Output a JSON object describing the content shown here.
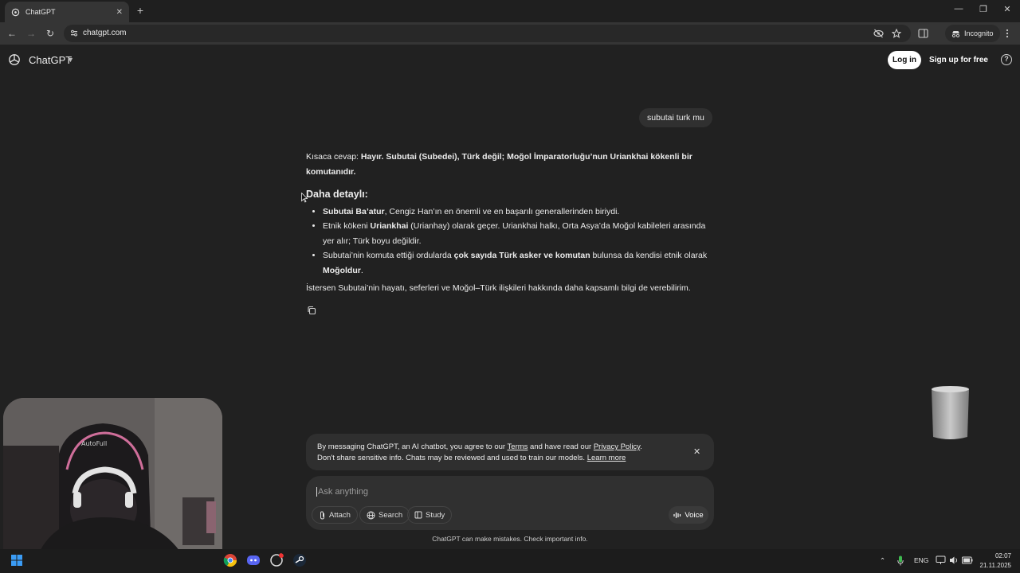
{
  "browser": {
    "tab_title": "ChatGPT",
    "tab_close": "✕",
    "new_tab": "+",
    "url": "chatgpt.com",
    "incognito_label": "Incognito",
    "window_controls": [
      "—",
      "❐",
      "✕"
    ]
  },
  "header": {
    "app_title": "ChatGPT",
    "login_label": "Log in",
    "signup_label": "Sign up for free",
    "help_glyph": "?"
  },
  "conversation": {
    "user_message": "subutai turk mu",
    "answer": {
      "intro_prefix": "Kısaca cevap: ",
      "intro_bold": "Hayır. Subutai (Subedei), Türk değil; Moğol İmparatorluğu’nun Uriankhai kökenli bir komutanıdır.",
      "heading": "Daha detaylı:",
      "bullets": [
        {
          "bold": "Subutai Ba’atur",
          "text": ", Cengiz Han’ın en önemli ve en başarılı generallerinden biriydi."
        },
        {
          "pre": "Etnik kökeni ",
          "bold": "Uriankhai",
          "text": " (Urianhay) olarak geçer. Uriankhai halkı, Orta Asya’da Moğol kabileleri arasında yer alır; Türk boyu değildir."
        },
        {
          "pre": "Subutai’nin komuta ettiği ordularda ",
          "bold": "çok sayıda Türk asker ve komutan",
          "text": " bulunsa da kendisi etnik olarak ",
          "bold2": "Moğoldur",
          "post": "."
        }
      ],
      "closing": "İstersen Subutai’nin hayatı, seferleri ve Moğol–Türk ilişkileri hakkında daha kapsamlı bilgi de verebilirim."
    }
  },
  "notice": {
    "line1_a": "By messaging ChatGPT, an AI chatbot, you agree to our ",
    "terms": "Terms",
    "line1_b": " and have read our ",
    "privacy": "Privacy Policy",
    "line1_c": ".",
    "line2_a": "Don't share sensitive info. Chats may be reviewed and used to train our models. ",
    "learn_more": "Learn more",
    "close": "✕"
  },
  "composer": {
    "placeholder": "Ask anything",
    "attach": "Attach",
    "search": "Search",
    "study": "Study",
    "voice": "Voice"
  },
  "footnote": "ChatGPT can make mistakes. Check important info.",
  "taskbar": {
    "language": "ENG",
    "time": "02:07",
    "date": "21.11.2025"
  },
  "colors": {
    "page_bg": "#212121",
    "chrome_bg": "#353535",
    "bubble_bg": "#303030"
  }
}
